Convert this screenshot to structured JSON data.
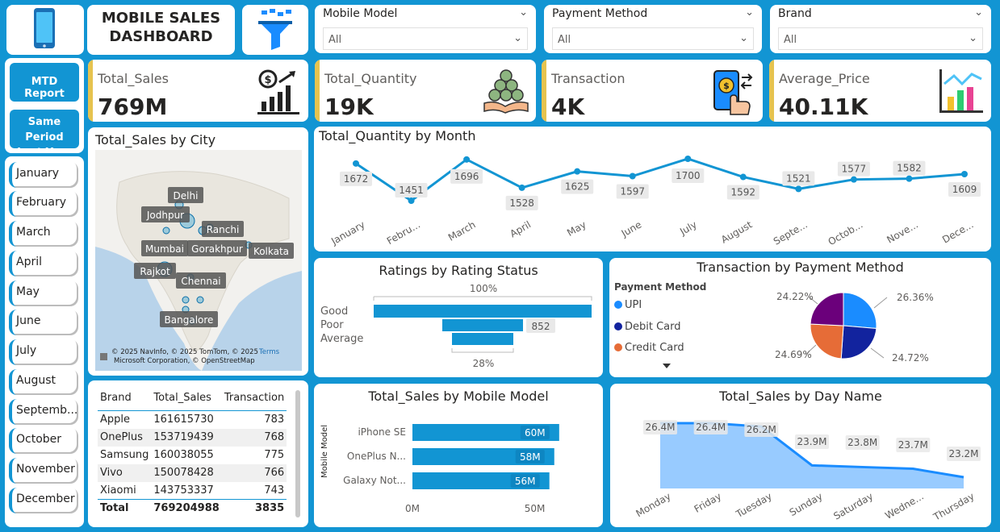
{
  "header": {
    "title_line1": "MOBILE SALES",
    "title_line2": "DASHBOARD"
  },
  "icons": {
    "logo": "mobile-phone-icon",
    "filter": "filter-funnel-icon",
    "chevron": "chevron-down-icon"
  },
  "slicers": [
    {
      "title": "Mobile Model",
      "value": "All"
    },
    {
      "title": "Payment Method",
      "value": "All"
    },
    {
      "title": "Brand",
      "value": "All"
    }
  ],
  "nav": {
    "mtd_report": "MTD Report",
    "same_period_line1": "Same Period",
    "same_period_line2": "Last Year"
  },
  "months": [
    "January",
    "February",
    "March",
    "April",
    "May",
    "June",
    "July",
    "August",
    "Septemb...",
    "October",
    "November",
    "December"
  ],
  "kpis": [
    {
      "label": "Total_Sales",
      "value": "769M",
      "icon": "money-bar-chart-icon"
    },
    {
      "label": "Total_Quantity",
      "value": "19K",
      "icon": "coin-stack-hand-icon"
    },
    {
      "label": "Transaction",
      "value": "4K",
      "icon": "mobile-payment-icon"
    },
    {
      "label": "Average_Price",
      "value": "40.11K",
      "icon": "growth-bars-icon"
    }
  ],
  "map": {
    "title": "Total_Sales by City",
    "cities": [
      "Delhi",
      "Jodhpur",
      "Ranchi",
      "Mumbai",
      "Gorakhpur",
      "Kolkata",
      "Rajkot",
      "Chennai",
      "Bangalore"
    ],
    "attribution_line1": "© 2025 NavInfo, © 2025 TomTom, © 2025",
    "terms": "Terms",
    "attribution_line2": "Microsoft Corporation, © OpenStreetMap"
  },
  "brand_table": {
    "headers": [
      "Brand",
      "Total_Sales",
      "Transaction"
    ],
    "rows": [
      [
        "Apple",
        "161615730",
        "783"
      ],
      [
        "OnePlus",
        "153719439",
        "768"
      ],
      [
        "Samsung",
        "160038055",
        "775"
      ],
      [
        "Vivo",
        "150078428",
        "766"
      ],
      [
        "Xiaomi",
        "143753337",
        "743"
      ]
    ],
    "total": [
      "Total",
      "769204988",
      "3835"
    ]
  },
  "chart_data": [
    {
      "type": "line",
      "title": "Total_Quantity by Month",
      "categories": [
        "January",
        "Febru...",
        "March",
        "April",
        "May",
        "June",
        "July",
        "August",
        "Septe...",
        "Octob...",
        "Nove...",
        "Dece..."
      ],
      "values": [
        1672,
        1451,
        1696,
        1528,
        1625,
        1597,
        1700,
        1592,
        1521,
        1577,
        1582,
        1609
      ],
      "color": "#1295d3"
    },
    {
      "type": "bar",
      "title": "Ratings by Rating Status",
      "categories": [
        "Good",
        "Poor",
        "Average"
      ],
      "data_labels": [
        "100%",
        "852",
        "28%"
      ],
      "color": "#1295d3"
    },
    {
      "type": "pie",
      "title": "Transaction by Payment Method",
      "legend_title": "Payment Method",
      "legend": [
        "UPI",
        "Debit Card",
        "Credit Card"
      ],
      "slices": [
        {
          "label": "26.36%",
          "value": 26.36,
          "color": "#1a8cff"
        },
        {
          "label": "24.72%",
          "value": 24.72,
          "color": "#12239e"
        },
        {
          "label": "24.69%",
          "value": 24.69,
          "color": "#e66c37"
        },
        {
          "label": "24.22%",
          "value": 24.22,
          "color": "#6b007b"
        }
      ]
    },
    {
      "type": "bar",
      "title": "Total_Sales by Mobile Model",
      "ylabel": "Mobile Model",
      "categories": [
        "iPhone SE",
        "OnePlus N...",
        "Galaxy Not..."
      ],
      "values": [
        60,
        58,
        56
      ],
      "labels": [
        "60M",
        "58M",
        "56M"
      ],
      "xticks": [
        "0M",
        "50M"
      ],
      "xlim": [
        0,
        66
      ],
      "color": "#1295d3"
    },
    {
      "type": "area",
      "title": "Total_Sales by Day Name",
      "categories": [
        "Monday",
        "Friday",
        "Tuesday",
        "Sunday",
        "Saturday",
        "Wedne...",
        "Thursday"
      ],
      "values": [
        26.4,
        26.4,
        26.2,
        23.9,
        23.8,
        23.7,
        23.2
      ],
      "labels": [
        "26.4M",
        "26.4M",
        "26.2M",
        "23.9M",
        "23.8M",
        "23.7M",
        "23.2M"
      ],
      "color": "#1a8cff"
    }
  ]
}
